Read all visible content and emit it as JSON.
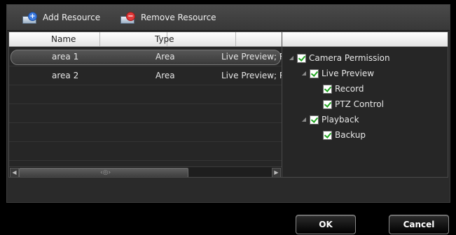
{
  "toolbar": {
    "add_resource_label": "Add Resource",
    "remove_resource_label": "Remove Resource",
    "add_icon": "add-resource-icon",
    "remove_icon": "remove-resource-icon"
  },
  "resource_table": {
    "columns": [
      "Name",
      "Type",
      ""
    ],
    "rows": [
      {
        "name": "area 1",
        "type": "Area",
        "permissions": "Live Preview; Re",
        "selected": true
      },
      {
        "name": "area 2",
        "type": "Area",
        "permissions": "Live Preview; Re",
        "selected": false
      }
    ],
    "scrollbar": {
      "left_arrow": "◀",
      "right_arrow": "▶",
      "grip": "‹◎›"
    }
  },
  "permission_tree": {
    "root": {
      "label": "Camera Permission",
      "checked": true,
      "expanded": true
    },
    "groups": [
      {
        "label": "Live Preview",
        "checked": true,
        "expanded": true,
        "children": [
          {
            "label": "Record",
            "checked": true
          },
          {
            "label": "PTZ Control",
            "checked": true
          }
        ]
      },
      {
        "label": "Playback",
        "checked": true,
        "expanded": true,
        "children": [
          {
            "label": "Backup",
            "checked": true
          }
        ]
      }
    ]
  },
  "footer": {
    "ok_label": "OK",
    "cancel_label": "Cancel"
  },
  "colors": {
    "background": "#000000",
    "panel": "#2a2a2a",
    "check": "#1fa51f",
    "header": "#ffffff"
  }
}
